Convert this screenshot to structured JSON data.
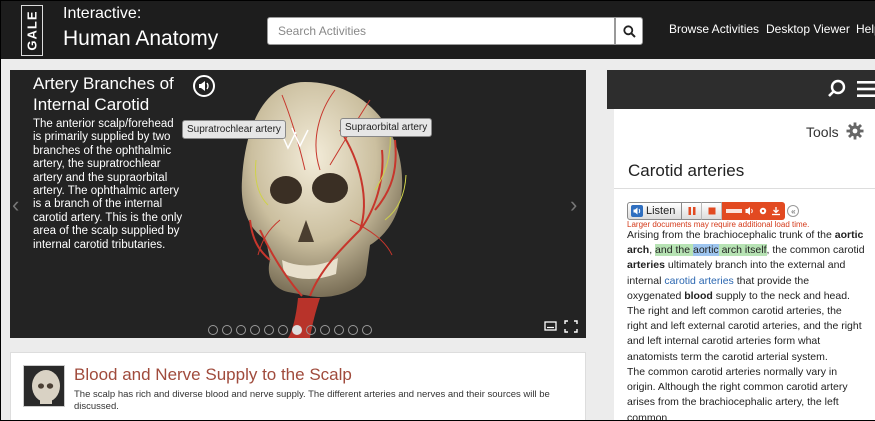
{
  "header": {
    "logo_text": "GALE",
    "brand_line1": "Interactive:",
    "brand_line2": "Human Anatomy",
    "search_placeholder": "Search Activities",
    "nav": [
      "Browse Activities",
      "Desktop Viewer",
      "Help"
    ]
  },
  "slideshow": {
    "title": "Artery Branches of Internal Carotid",
    "text": "The anterior scalp/forehead is primarily supplied by two branches of the ophthalmic artery, the supratrochlear artery and the supraorbital artery. The ophthalmic artery is a branch of the internal carotid artery. This is the only area of the scalp supplied by internal carotid tributaries.",
    "callouts": [
      "Supratrochlear artery",
      "Supraorbital artery"
    ],
    "slide_count": 12,
    "active_slide": 6,
    "prev_arrow": "‹",
    "next_arrow": "›"
  },
  "article": {
    "title": "Blood and Nerve Supply to the Scalp",
    "description": "The scalp has rich and diverse blood and nerve supply. The different arteries and nerves and their sources will be discussed."
  },
  "panel": {
    "tools_label": "Tools",
    "section_title": "Carotid arteries",
    "readspeaker": {
      "listen_label": "Listen",
      "note": "Larger documents may require additional load time."
    },
    "paragraph1": {
      "t1": "Arising from the brachiocephalic trunk of the ",
      "b1": "aortic arch",
      "t2": ", ",
      "hl1": "and the ",
      "hl2": "aortic",
      "hl3": " arch itself",
      "t3": ", the common carotid ",
      "b2": "arteries",
      "t4": " ultimately branch into the external and internal ",
      "link": "carotid arteries",
      "t5": " that provide the oxygenated ",
      "b3": "blood",
      "t6": " supply to the neck and head. The right and left common carotid arteries, the right and left external carotid arteries, and the right and left internal carotid arteries form what anatomists term the carotid arterial system."
    },
    "paragraph2": "The common carotid arteries normally vary in origin. Although the right common carotid artery arises from the brachiocephalic artery, the left common"
  },
  "colors": {
    "header_bg": "#1d1d1d",
    "article_title": "#a04b3c",
    "readspeaker_accent": "#e24a21",
    "link": "#2a66b0"
  }
}
